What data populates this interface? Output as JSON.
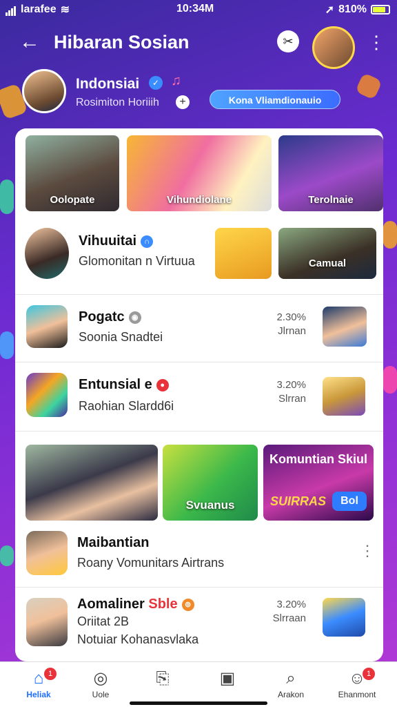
{
  "status_bar": {
    "carrier": "larafee",
    "time": "10:34M",
    "battery": "810%",
    "battery_fill": 0.81
  },
  "header": {
    "title": "Hibaran Sosian",
    "back_icon": "arrow-left-icon",
    "tool_icon": "tools-icon"
  },
  "profile": {
    "name": "Indonsiai",
    "subtitle": "Rosimiton Horiiih",
    "verified_icon": "verified-icon",
    "music_icon": "music-note-icon",
    "chip": "Kona Vliamdionauio"
  },
  "top_tiles": [
    {
      "caption": "Oolopate"
    },
    {
      "caption": "Vihundiolane"
    },
    {
      "caption": "Terolnaie"
    }
  ],
  "featured_row": {
    "title": "Vihuuitai",
    "subtitle": "Glomonitan n Virtuua",
    "thumb_caption": "Camual"
  },
  "list_items": [
    {
      "title": "Pogatc",
      "subtitle": "Soonia  Snadtei",
      "stat_value": "2.30%",
      "stat_label": "Jlrnan",
      "badge_color": "#9a9a9a"
    },
    {
      "title": "Entunsial e",
      "subtitle": "Raohian Slardd6i",
      "stat_value": "3.20%",
      "stat_label": "Slrran",
      "badge_color": "#e8333a"
    }
  ],
  "promo_tiles": [
    {
      "caption": "Svuanus"
    },
    {
      "heading": "Komuntian Skiul",
      "tag": "SUIRRAS",
      "button": "Bol"
    }
  ],
  "post": {
    "title": "Maibantian",
    "subtitle": "Roany Vomunitars Airtrans"
  },
  "bottom_item": {
    "title_main": "Aomaliner",
    "title_accent": "Sble",
    "line2": "Oriitat  2B",
    "line3": "Notuiar Kohanasvlaka",
    "stat_value": "3.20%",
    "stat_label": "Slrraan",
    "accent_color": "#e8333a"
  },
  "nav": [
    {
      "label": "Heliak",
      "icon": "home-icon",
      "active": true,
      "badge": "1"
    },
    {
      "label": "Uole",
      "icon": "location-pin-icon",
      "active": false
    },
    {
      "label": "",
      "icon": "document-icon",
      "active": false
    },
    {
      "label": "",
      "icon": "archive-icon",
      "active": false
    },
    {
      "label": "Arakon",
      "icon": "search-icon",
      "active": false
    },
    {
      "label": "Ehanmont",
      "icon": "person-icon",
      "active": false,
      "badge": "1"
    }
  ],
  "colors": {
    "accent": "#1f6fff",
    "header_bg": "#5a2ec8",
    "badge_red": "#e8333a"
  }
}
